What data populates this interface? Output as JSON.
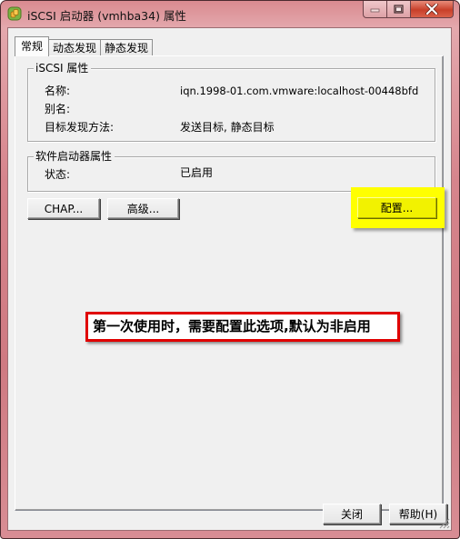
{
  "window": {
    "title": "iSCSI 启动器 (vmhba34) 属性",
    "icon": "vsphere-app-icon",
    "caption_buttons": [
      "minimize",
      "maximize",
      "close"
    ]
  },
  "tabs": [
    {
      "label": "常规",
      "active": true
    },
    {
      "label": "动态发现",
      "active": false
    },
    {
      "label": "静态发现",
      "active": false
    }
  ],
  "iscsi_properties": {
    "legend": "iSCSI 属性",
    "rows": [
      {
        "label": "名称:",
        "value": "iqn.1998-01.com.vmware:localhost-00448bfd"
      },
      {
        "label": "别名:",
        "value": ""
      },
      {
        "label": "目标发现方法:",
        "value": "发送目标, 静态目标"
      }
    ]
  },
  "software_initiator": {
    "legend": "软件启动器属性",
    "rows": [
      {
        "label": "状态:",
        "value": "已启用"
      }
    ]
  },
  "buttons": {
    "chap": "CHAP...",
    "advanced": "高级...",
    "configure": "配置...",
    "close": "关闭",
    "help": "帮助(H)"
  },
  "annotation": {
    "text": "第一次使用时，需要配置此选项,默认为非启用",
    "highlight_color": "#ffff00",
    "border_color": "#e00000"
  }
}
